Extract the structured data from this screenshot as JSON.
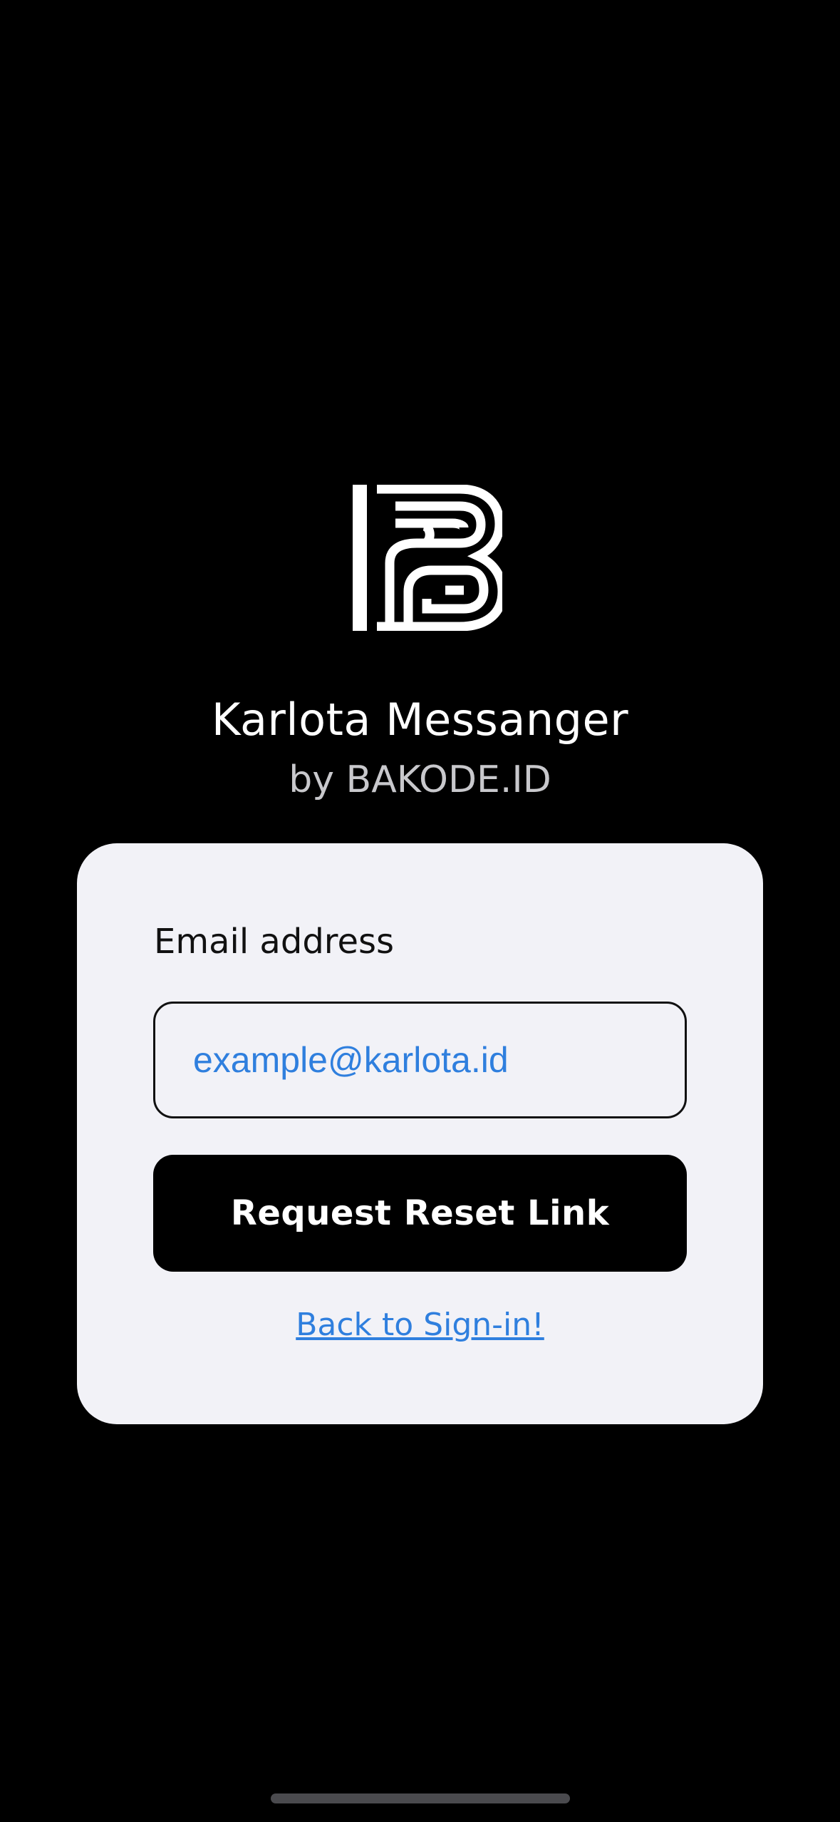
{
  "app": {
    "title": "Karlota Messanger",
    "subtitle": "by BAKODE.ID",
    "logo_icon": "bakode-b-logo-icon"
  },
  "form": {
    "email_label": "Email address",
    "email_value": "",
    "email_placeholder": "example@karlota.id",
    "submit_label": "Request Reset Link",
    "back_link_label": "Back to Sign-in!"
  },
  "colors": {
    "background": "#000000",
    "card": "#f2f2f7",
    "accent_link": "#2f7fde",
    "button": "#000000",
    "button_text": "#ffffff"
  }
}
